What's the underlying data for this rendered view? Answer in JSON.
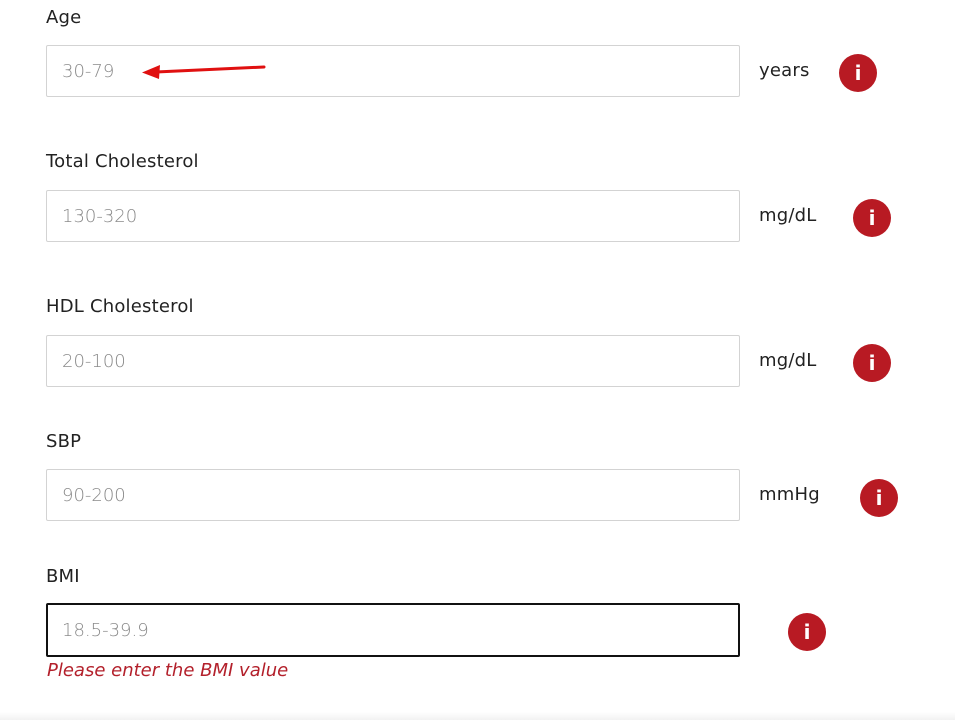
{
  "fields": [
    {
      "label": "Age",
      "placeholder": "30-79",
      "value": "",
      "unit": "years"
    },
    {
      "label": "Total Cholesterol",
      "placeholder": "130-320",
      "value": "",
      "unit": "mg/dL"
    },
    {
      "label": "HDL Cholesterol",
      "placeholder": "20-100",
      "value": "",
      "unit": "mg/dL"
    },
    {
      "label": "SBP",
      "placeholder": "90-200",
      "value": "",
      "unit": "mmHg"
    },
    {
      "label": "BMI",
      "placeholder": "18.5-39.9",
      "value": "",
      "unit": "",
      "error": "Please enter the BMI value"
    }
  ],
  "info_icon_glyph": "i",
  "colors": {
    "accent_red": "#b81a23",
    "error_red": "#b3202b",
    "annotation_arrow": "#e01010"
  }
}
